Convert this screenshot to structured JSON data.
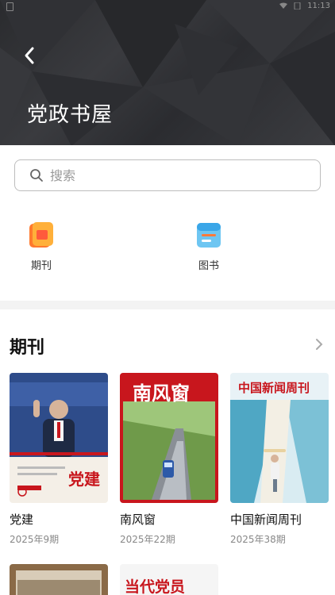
{
  "status_bar": {
    "time": "11:13"
  },
  "header": {
    "title": "党政书屋"
  },
  "search": {
    "placeholder": "搜索",
    "value": ""
  },
  "categories": [
    {
      "label": "期刊",
      "icon": "periodical-icon"
    },
    {
      "label": "图书",
      "icon": "book-icon"
    }
  ],
  "periodicals": {
    "title": "期刊",
    "items": [
      {
        "name": "党建",
        "issue": "2025年9期",
        "cover_title": "党建"
      },
      {
        "name": "南风窗",
        "issue": "2025年22期",
        "cover_title": "南风窗"
      },
      {
        "name": "中国新闻周刊",
        "issue": "2025年38期",
        "cover_title": "中国新闻周刊"
      }
    ],
    "next_row": [
      {
        "cover_title": ""
      },
      {
        "cover_title": "当代党员"
      }
    ]
  },
  "colors": {
    "header_bg": "#2e2f33",
    "accent_red": "#c8161d"
  }
}
